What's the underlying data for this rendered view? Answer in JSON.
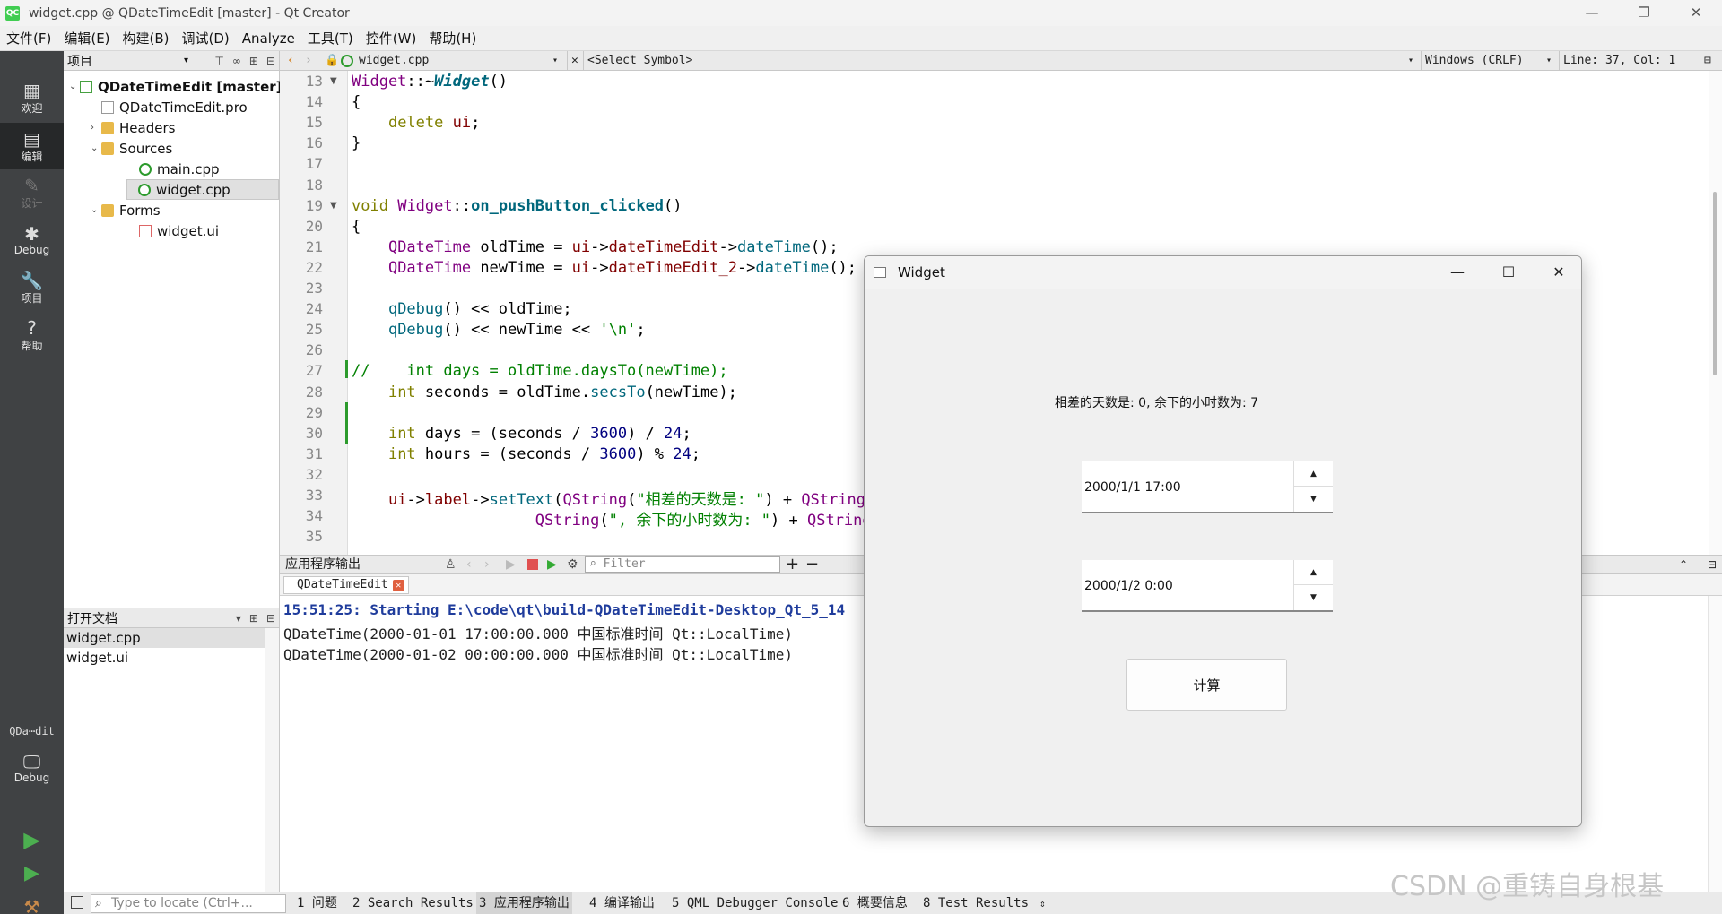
{
  "window": {
    "title": "widget.cpp @ QDateTimeEdit [master] - Qt Creator",
    "logo": "QC",
    "minimize": "—",
    "maximize": "❐",
    "close": "✕"
  },
  "menu": [
    "文件(F)",
    "编辑(E)",
    "构建(B)",
    "调试(D)",
    "Analyze",
    "工具(T)",
    "控件(W)",
    "帮助(H)"
  ],
  "modes": [
    {
      "label": "欢迎",
      "icon": "grid-icon"
    },
    {
      "label": "编辑",
      "icon": "edit-icon"
    },
    {
      "label": "设计",
      "icon": "pencil-icon"
    },
    {
      "label": "Debug",
      "icon": "bug-icon"
    },
    {
      "label": "项目",
      "icon": "wrench-icon"
    },
    {
      "label": "帮助",
      "icon": "help-icon"
    }
  ],
  "kit": {
    "name": "QDa⋯dit",
    "mode": "Debug"
  },
  "project": {
    "header": "项目",
    "tree": [
      {
        "label": "QDateTimeEdit [master]",
        "icon": "proj",
        "arrow": "⌄",
        "level": 0,
        "bold": true
      },
      {
        "label": "QDateTimeEdit.pro",
        "icon": "file",
        "arrow": "",
        "level": 1
      },
      {
        "label": "Headers",
        "icon": "folder",
        "arrow": "›",
        "level": 1
      },
      {
        "label": "Sources",
        "icon": "folder",
        "arrow": "⌄",
        "level": 1
      },
      {
        "label": "main.cpp",
        "icon": "cpp",
        "arrow": "",
        "level": 2
      },
      {
        "label": "widget.cpp",
        "icon": "cpp",
        "arrow": "",
        "level": 2,
        "selected": true
      },
      {
        "label": "Forms",
        "icon": "folder",
        "arrow": "⌄",
        "level": 1
      },
      {
        "label": "widget.ui",
        "icon": "ui",
        "arrow": "",
        "level": 2
      }
    ]
  },
  "open_docs": {
    "header": "打开文档",
    "items": [
      "widget.cpp",
      "widget.ui"
    ]
  },
  "editor_toolbar": {
    "file": "widget.cpp",
    "symbol": "<Select Symbol>",
    "encoding": "Windows (CRLF)",
    "position": "Line: 37, Col: 1"
  },
  "code_lines": [
    {
      "n": "13",
      "fold": true,
      "html": "<span class=\"ty\">Widget</span>::~<span class=\"fnbi\">Widget</span>()"
    },
    {
      "n": "14",
      "html": "{"
    },
    {
      "n": "15",
      "html": "    <span class=\"kw\">delete</span> <span class=\"mbr\">ui</span>;"
    },
    {
      "n": "16",
      "html": "}"
    },
    {
      "n": "17",
      "html": ""
    },
    {
      "n": "18",
      "html": ""
    },
    {
      "n": "19",
      "fold": true,
      "html": "<span class=\"kw\">void</span> <span class=\"ty\">Widget</span>::<span class=\"fnb\">on_pushButton_clicked</span>()"
    },
    {
      "n": "20",
      "html": "{"
    },
    {
      "n": "21",
      "html": "    <span class=\"ty\">QDateTime</span> oldTime = <span class=\"mbr\">ui</span>-><span class=\"mbr\">dateTimeEdit</span>-><span class=\"fn\">dateTime</span>();"
    },
    {
      "n": "22",
      "html": "    <span class=\"ty\">QDateTime</span> newTime = <span class=\"mbr\">ui</span>-><span class=\"mbr\">dateTimeEdit_2</span>-><span class=\"fn\">dateTime</span>();"
    },
    {
      "n": "23",
      "html": ""
    },
    {
      "n": "24",
      "html": "    <span class=\"fn\">qDebug</span>() << oldTime;"
    },
    {
      "n": "25",
      "html": "    <span class=\"fn\">qDebug</span>() << newTime << <span class=\"str\">'\\n'</span>;"
    },
    {
      "n": "26",
      "html": ""
    },
    {
      "n": "27",
      "html": "<span class=\"cm\">//    int days = oldTime.daysTo(newTime);</span>"
    },
    {
      "n": "28",
      "html": "    <span class=\"kw\">int</span> seconds = oldTime.<span class=\"fn\">secsTo</span>(newTime);"
    },
    {
      "n": "29",
      "html": ""
    },
    {
      "n": "30",
      "html": "    <span class=\"kw\">int</span> days = (seconds / <span class=\"num\">3600</span>) / <span class=\"num\">24</span>;"
    },
    {
      "n": "31",
      "html": "    <span class=\"kw\">int</span> hours = (seconds / <span class=\"num\">3600</span>) % <span class=\"num\">24</span>;"
    },
    {
      "n": "32",
      "html": ""
    },
    {
      "n": "33",
      "html": "    <span class=\"mbr\">ui</span>-><span class=\"mbr\">label</span>-><span class=\"fn\">setText</span>(<span class=\"ty\">QString</span>(<span class=\"str\">\"相差的天数是: \"</span>) + <span class=\"ty\">QString</span>::<span class=\"fn\">number</span>(days) +"
    },
    {
      "n": "34",
      "html": "                    <span class=\"ty\">QString</span>(<span class=\"str\">\", 余下的小时数为: \"</span>) + <span class=\"ty\">QString</span>::<span class=\"fn\">number</span>(hours));"
    },
    {
      "n": "35",
      "html": ""
    }
  ],
  "output": {
    "header": "应用程序输出",
    "filter_placeholder": "Filter",
    "tab": "QDateTimeEdit",
    "lines": [
      {
        "text": "15:51:25: Starting E:\\code\\qt\\build-QDateTimeEdit-Desktop_Qt_5_14",
        "start": true
      },
      {
        "text": "QDateTime(2000-01-01 17:00:00.000 中国标准时间 Qt::LocalTime)"
      },
      {
        "text": "QDateTime(2000-01-02 00:00:00.000 中国标准时间 Qt::LocalTime)"
      }
    ]
  },
  "statusbar": {
    "locate_placeholder": "Type to locate (Ctrl+...",
    "tabs": [
      "1 问题",
      "2 Search Results",
      "3 应用程序输出",
      "4 编译输出",
      "5 QML Debugger Console",
      "6 概要信息",
      "8 Test Results"
    ]
  },
  "widget_window": {
    "title": "Widget",
    "label": "相差的天数是: 0, 余下的小时数为: 7",
    "datetime1": "2000/1/1 17:00",
    "datetime2": "2000/1/2 0:00",
    "button": "计算"
  },
  "watermark": "CSDN @重铸自身根基"
}
